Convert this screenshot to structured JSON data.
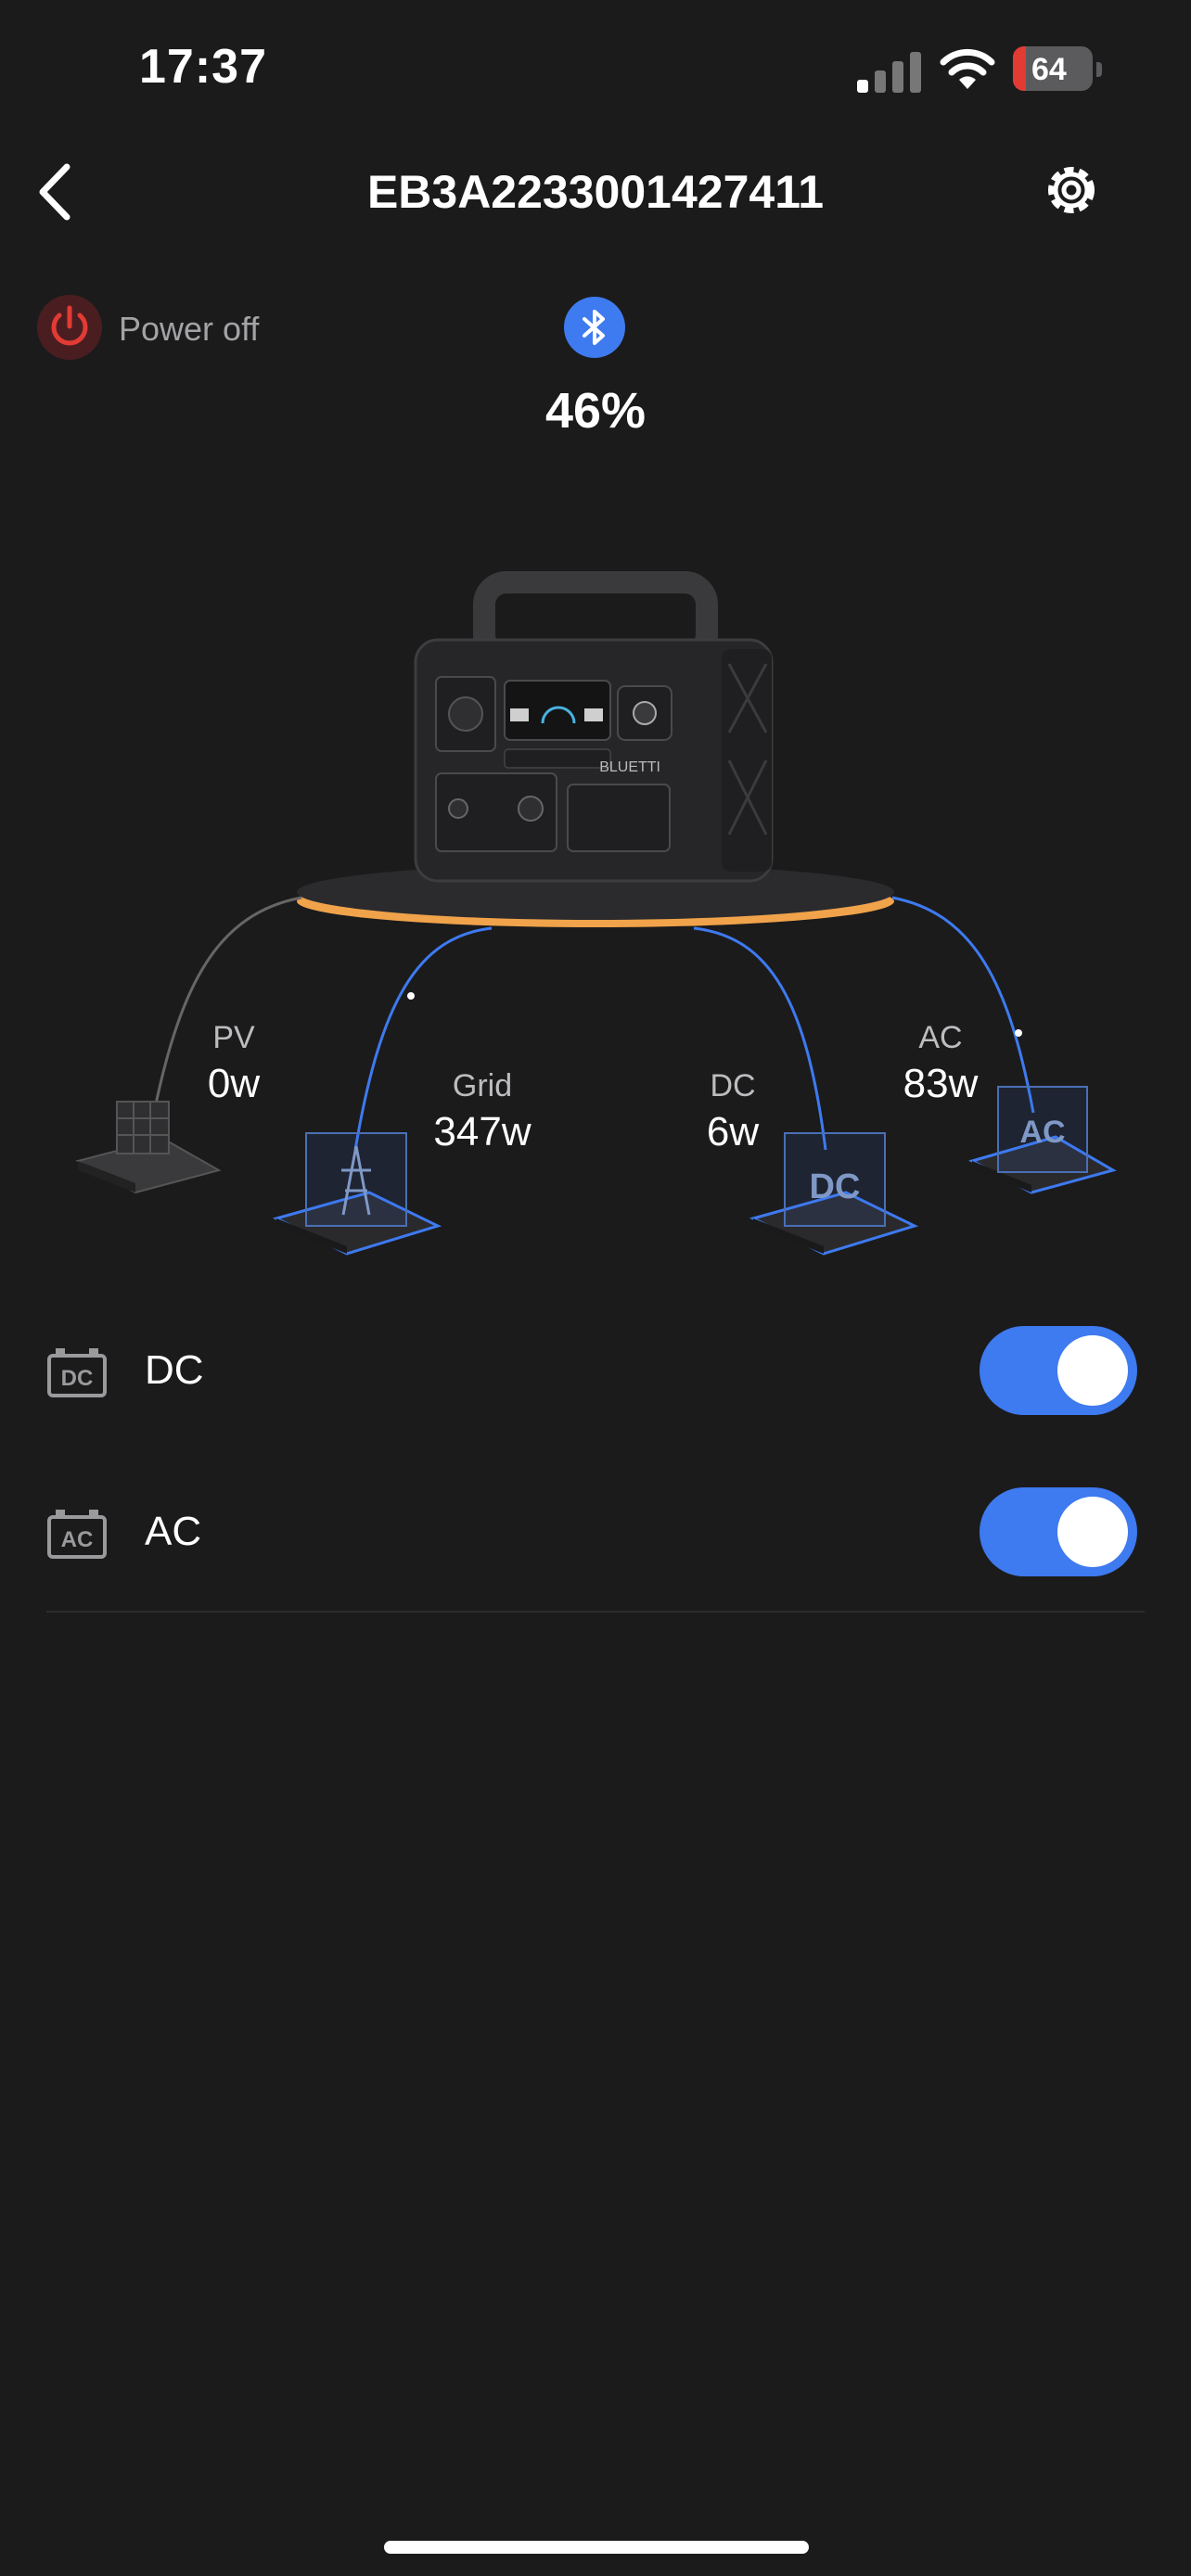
{
  "status_bar": {
    "time": "17:37",
    "battery_level": "64"
  },
  "header": {
    "title": "EB3A2233001427411"
  },
  "device": {
    "power_label": "Power off",
    "battery_percent": "46%"
  },
  "flows": [
    {
      "name": "PV",
      "value": "0w"
    },
    {
      "name": "Grid",
      "value": "347w"
    },
    {
      "name": "DC",
      "value": "6w"
    },
    {
      "name": "AC",
      "value": "83w"
    }
  ],
  "device_label": "BLUETTI",
  "outputs": [
    {
      "label": "DC",
      "icon_text": "DC",
      "enabled": true
    },
    {
      "label": "AC",
      "icon_text": "AC",
      "enabled": true
    }
  ],
  "colors": {
    "accent": "#3e7af0",
    "platform_ring": "#f0a34a",
    "power_off": "#e23b34"
  }
}
